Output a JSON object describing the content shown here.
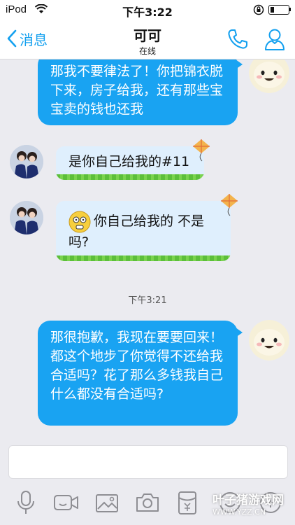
{
  "status_bar": {
    "carrier": "iPod",
    "time": "下午3:22"
  },
  "nav": {
    "back_label": "消息",
    "title": "可可",
    "subtitle": "在线"
  },
  "messages": [
    {
      "side": "right",
      "text": "那我不要律法了！你把锦衣脱下来，房子给我，还有那些宝宝卖的钱也还我"
    },
    {
      "side": "left",
      "text": "是你自己给我的#11"
    },
    {
      "side": "left",
      "text": "你自己给我的  不是吗?"
    },
    {
      "side": "right",
      "text": "那很抱歉，我现在要要回来！都这个地步了你觉得不还给我合适吗？花了那么多钱我自己什么都没有合适吗?"
    }
  ],
  "timestamp": "下午3:21",
  "input": {
    "value": ""
  },
  "toolbar": [
    "microphone-icon",
    "video-icon",
    "image-icon",
    "camera-icon",
    "red-packet-icon",
    "emoji-icon",
    "plus-icon"
  ],
  "watermark": {
    "line1": "叶子猪游戏网",
    "line2": "WWW.YZZ.CN"
  },
  "colors": {
    "accent": "#13a0ef",
    "bubble_right": "#19a3f2",
    "bubble_left": "#dfeffd",
    "background": "#ebebf0"
  }
}
